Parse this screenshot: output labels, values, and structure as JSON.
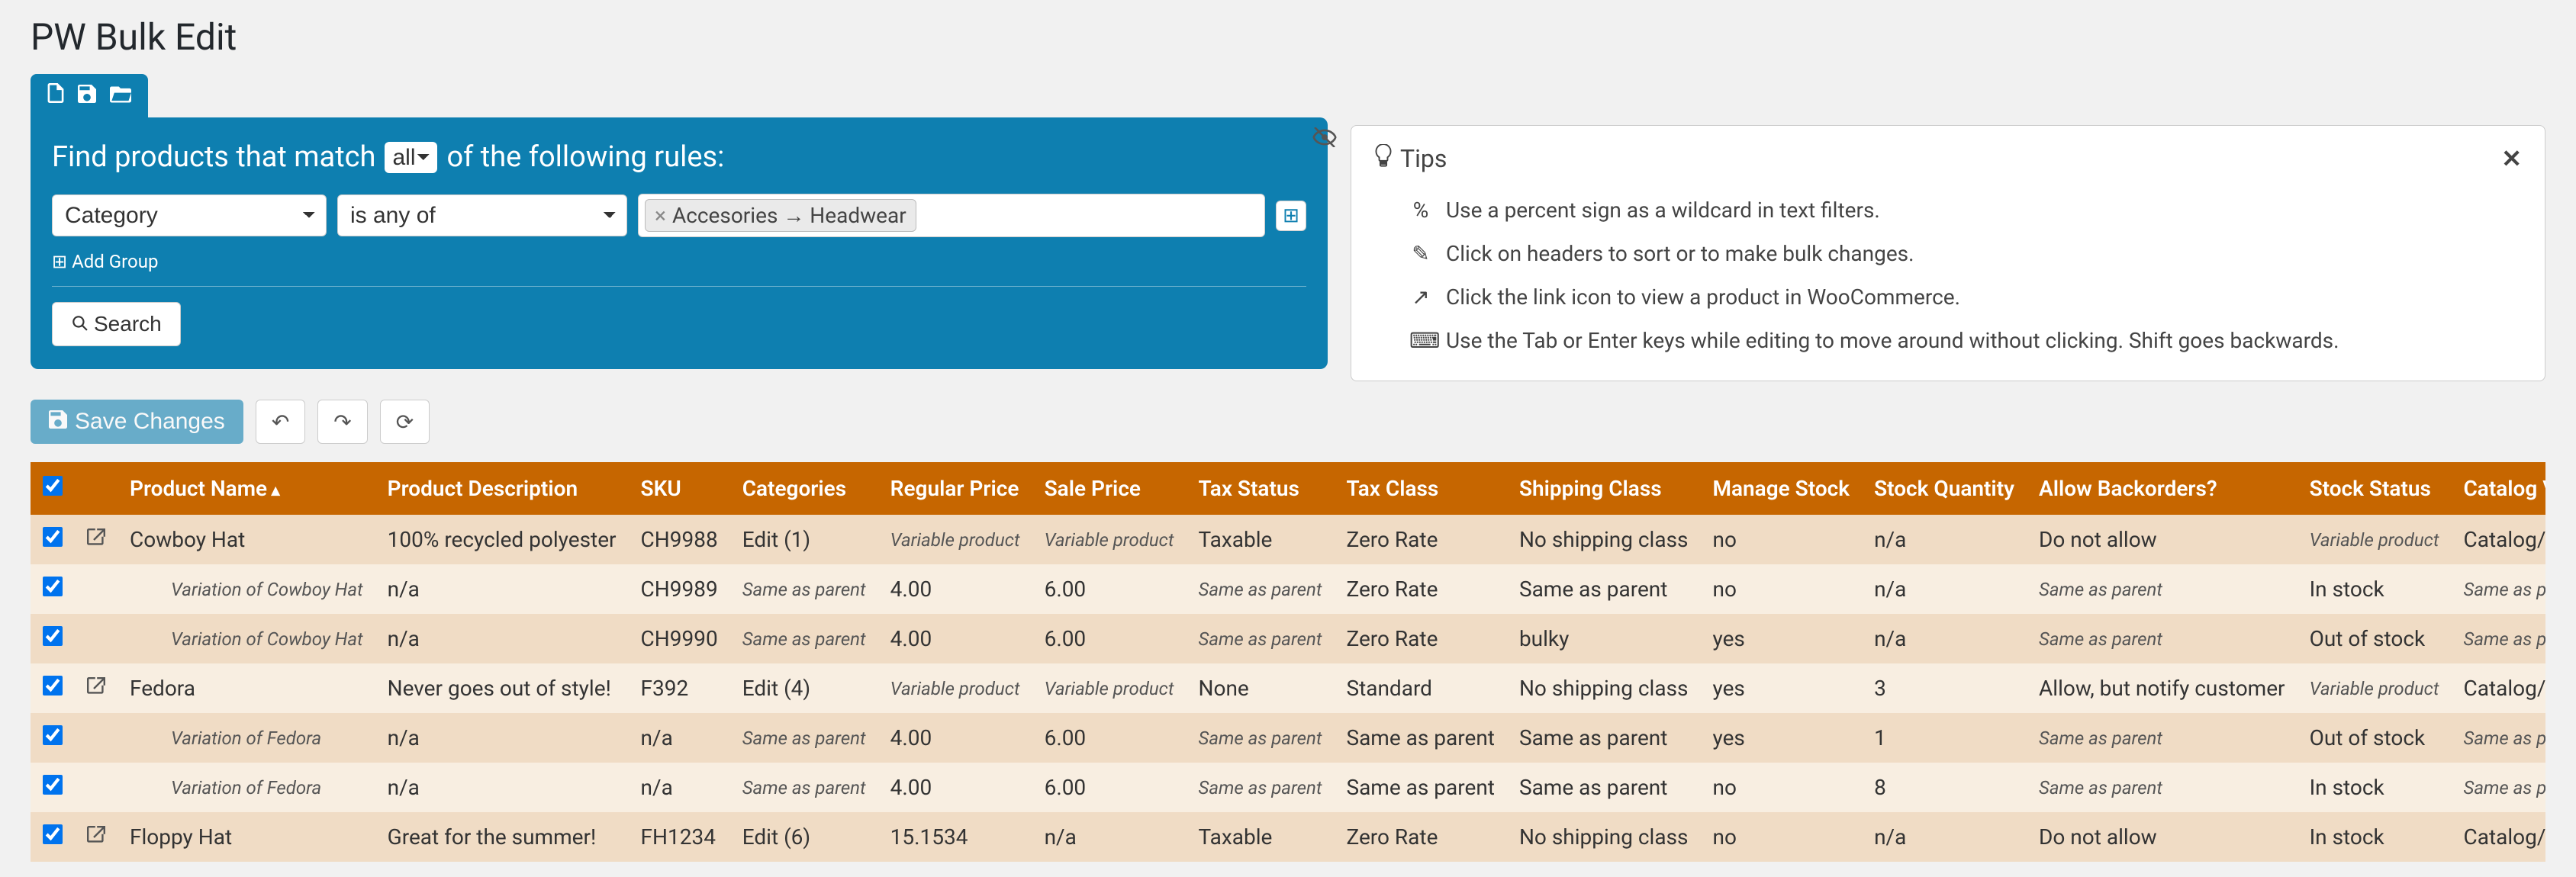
{
  "page_title": "PW Bulk Edit",
  "filter": {
    "prefix": "Find products that match",
    "match_mode": "all",
    "suffix": "of the following rules:",
    "field_select": "Category",
    "operator_select": "is any of",
    "tag_text": "Accesories → Headwear",
    "add_group": "Add Group",
    "search_label": "Search"
  },
  "tips": {
    "title": "Tips",
    "items": [
      {
        "icon": "%",
        "text": "Use a percent sign as a wildcard in text filters."
      },
      {
        "icon": "✎",
        "text": "Click on headers to sort or to make bulk changes."
      },
      {
        "icon": "↗",
        "text": "Click the link icon to view a product in WooCommerce."
      },
      {
        "icon": "⌨",
        "text": "Use the Tab or Enter keys while editing to move around without clicking. Shift goes backwards."
      }
    ]
  },
  "actions": {
    "save": "Save Changes"
  },
  "columns": [
    "",
    "",
    "Product Name",
    "Product Description",
    "SKU",
    "Categories",
    "Regular Price",
    "Sale Price",
    "Tax Status",
    "Tax Class",
    "Shipping Class",
    "Manage Stock",
    "Stock Quantity",
    "Allow Backorders?",
    "Stock Status",
    "Catalog Vis"
  ],
  "rows": [
    {
      "type": "product",
      "link": true,
      "name": "Cowboy Hat",
      "desc": "100% recycled polyester",
      "sku": "CH9988",
      "categories": "Edit (1)",
      "reg_price": "Variable product",
      "reg_price_italic": true,
      "sale_price": "Variable product",
      "sale_price_italic": true,
      "tax_status": "Taxable",
      "tax_class": "Zero Rate",
      "shipping": "No shipping class",
      "manage_stock": "no",
      "stock_qty": "n/a",
      "backorders": "Do not allow",
      "stock_status": "Variable product",
      "stock_status_italic": true,
      "catalog": "Catalog/se"
    },
    {
      "type": "variation",
      "link": false,
      "name": "Variation of Cowboy Hat",
      "desc": "n/a",
      "sku": "CH9989",
      "categories": "Same as parent",
      "categories_italic": true,
      "reg_price": "4.00",
      "sale_price": "6.00",
      "tax_status": "Same as parent",
      "tax_status_italic": true,
      "tax_class": "Zero Rate",
      "shipping": "Same as parent",
      "manage_stock": "no",
      "stock_qty": "n/a",
      "backorders": "Same as parent",
      "backorders_italic": true,
      "stock_status": "In stock",
      "catalog": "Same as paren",
      "catalog_italic": true
    },
    {
      "type": "variation",
      "link": false,
      "name": "Variation of Cowboy Hat",
      "desc": "n/a",
      "sku": "CH9990",
      "categories": "Same as parent",
      "categories_italic": true,
      "reg_price": "4.00",
      "sale_price": "6.00",
      "tax_status": "Same as parent",
      "tax_status_italic": true,
      "tax_class": "Zero Rate",
      "shipping": "bulky",
      "manage_stock": "yes",
      "stock_qty": "n/a",
      "backorders": "Same as parent",
      "backorders_italic": true,
      "stock_status": "Out of stock",
      "catalog": "Same as paren",
      "catalog_italic": true
    },
    {
      "type": "product",
      "link": true,
      "name": "Fedora",
      "desc": "Never goes out of style!",
      "sku": "F392",
      "categories": "Edit (4)",
      "reg_price": "Variable product",
      "reg_price_italic": true,
      "sale_price": "Variable product",
      "sale_price_italic": true,
      "tax_status": "None",
      "tax_class": "Standard",
      "shipping": "No shipping class",
      "manage_stock": "yes",
      "stock_qty": "3",
      "backorders": "Allow, but notify customer",
      "stock_status": "Variable product",
      "stock_status_italic": true,
      "catalog": "Catalog/se"
    },
    {
      "type": "variation",
      "link": false,
      "name": "Variation of Fedora",
      "desc": "n/a",
      "sku": "n/a",
      "categories": "Same as parent",
      "categories_italic": true,
      "reg_price": "4.00",
      "sale_price": "6.00",
      "tax_status": "Same as parent",
      "tax_status_italic": true,
      "tax_class": "Same as parent",
      "shipping": "Same as parent",
      "manage_stock": "yes",
      "stock_qty": "1",
      "backorders": "Same as parent",
      "backorders_italic": true,
      "stock_status": "Out of stock",
      "catalog": "Same as paren",
      "catalog_italic": true
    },
    {
      "type": "variation",
      "link": false,
      "name": "Variation of Fedora",
      "desc": "n/a",
      "sku": "n/a",
      "categories": "Same as parent",
      "categories_italic": true,
      "reg_price": "4.00",
      "sale_price": "6.00",
      "tax_status": "Same as parent",
      "tax_status_italic": true,
      "tax_class": "Same as parent",
      "shipping": "Same as parent",
      "manage_stock": "no",
      "stock_qty": "8",
      "backorders": "Same as parent",
      "backorders_italic": true,
      "stock_status": "In stock",
      "catalog": "Same as paren",
      "catalog_italic": true
    },
    {
      "type": "product",
      "link": true,
      "name": "Floppy Hat",
      "desc": "Great for the summer!",
      "sku": "FH1234",
      "categories": "Edit (6)",
      "reg_price": "15.1534",
      "sale_price": "n/a",
      "tax_status": "Taxable",
      "tax_class": "Zero Rate",
      "shipping": "No shipping class",
      "manage_stock": "no",
      "stock_qty": "n/a",
      "backorders": "Do not allow",
      "stock_status": "In stock",
      "catalog": "Catalog/se"
    }
  ]
}
